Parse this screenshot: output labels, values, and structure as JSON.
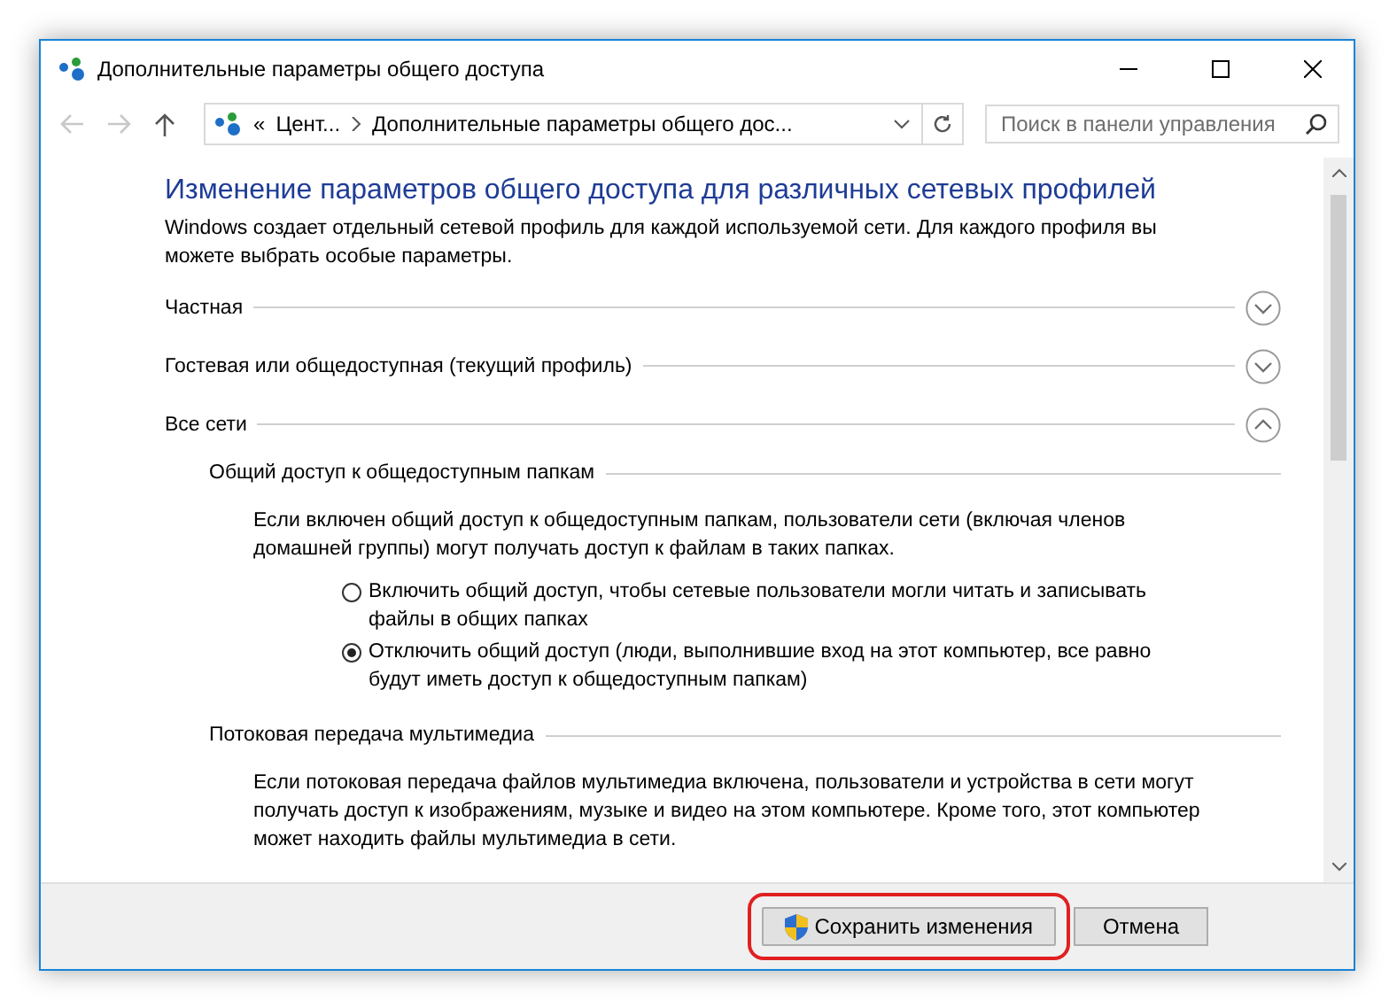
{
  "window": {
    "title": "Дополнительные параметры общего доступа"
  },
  "navigation": {
    "back_disabled": true,
    "forward_disabled": true
  },
  "address_bar": {
    "overflow": "«",
    "crumbs": [
      "Цент...",
      "Дополнительные параметры общего дос..."
    ]
  },
  "search": {
    "placeholder": "Поиск в панели управления"
  },
  "content": {
    "heading": "Изменение параметров общего доступа для различных сетевых профилей",
    "intro": "Windows создает отдельный сетевой профиль для каждой используемой сети. Для каждого профиля вы можете выбрать особые параметры.",
    "profiles": [
      {
        "label": "Частная",
        "expanded": false
      },
      {
        "label": "Гостевая или общедоступная (текущий профиль)",
        "expanded": false
      },
      {
        "label": "Все сети",
        "expanded": true,
        "groups": [
          {
            "title": "Общий доступ к общедоступным папкам",
            "description": "Если включен общий доступ к общедоступным папкам, пользователи сети (включая членов домашней группы) могут получать доступ к файлам в таких папках.",
            "options": [
              {
                "label": "Включить общий доступ, чтобы сетевые пользователи могли читать и записывать файлы в общих папках",
                "selected": false
              },
              {
                "label": "Отключить общий доступ (люди, выполнившие вход на этот компьютер, все равно будут иметь доступ к общедоступным папкам)",
                "selected": true
              }
            ]
          },
          {
            "title": "Потоковая передача мультимедиа",
            "description": "Если потоковая передача файлов мультимедиа включена, пользователи и устройства в сети могут получать доступ к изображениям, музыке и видео на этом компьютере. Кроме того, этот компьютер может находить файлы мультимедиа в сети."
          }
        ]
      }
    ]
  },
  "buttons": [
    {
      "label": "Сохранить изменения",
      "kind": "shield",
      "highlighted": true
    },
    {
      "label": "Отмена",
      "kind": "plain",
      "highlighted": false
    }
  ]
}
